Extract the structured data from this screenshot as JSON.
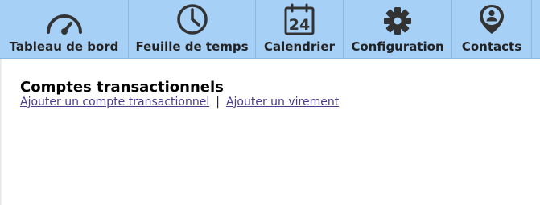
{
  "nav": {
    "items": [
      {
        "label": "Tableau de bord",
        "icon": "dashboard-gauge-icon"
      },
      {
        "label": "Feuille de temps",
        "icon": "clock-icon"
      },
      {
        "label": "Calendrier",
        "icon": "calendar-icon",
        "icon_text": "24"
      },
      {
        "label": "Configuration",
        "icon": "gear-icon"
      },
      {
        "label": "Contacts",
        "icon": "contact-pin-icon"
      }
    ]
  },
  "main": {
    "title": "Comptes transactionnels",
    "links": [
      {
        "label": "Ajouter un compte transactionnel"
      },
      {
        "label": "Ajouter un virement"
      }
    ],
    "separator": "|"
  },
  "colors": {
    "nav_bg": "#a7d0f7",
    "icon": "#333333",
    "link": "#4b3c8e"
  }
}
